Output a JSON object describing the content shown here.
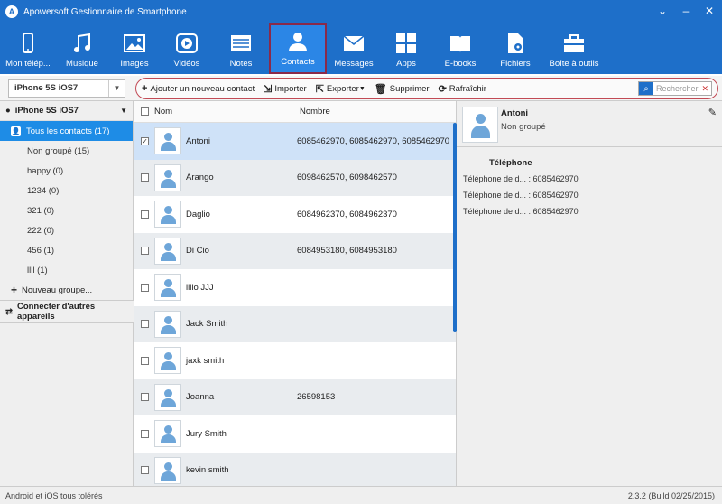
{
  "window": {
    "title": "Apowersoft Gestionnaire de Smartphone",
    "controls": [
      "⌄",
      "–",
      "✕"
    ]
  },
  "toolbar": {
    "items": [
      {
        "label": "Mon télép...",
        "icon": "phone-icon"
      },
      {
        "label": "Musique",
        "icon": "music-icon"
      },
      {
        "label": "Images",
        "icon": "images-icon"
      },
      {
        "label": "Vidéos",
        "icon": "video-icon"
      },
      {
        "label": "Notes",
        "icon": "notes-icon"
      },
      {
        "label": "Contacts",
        "icon": "contacts-icon"
      },
      {
        "label": "Messages",
        "icon": "messages-icon"
      },
      {
        "label": "Apps",
        "icon": "apps-icon"
      },
      {
        "label": "E-books",
        "icon": "ebook-icon"
      },
      {
        "label": "Fichiers",
        "icon": "files-icon"
      },
      {
        "label": "Boîte à outils",
        "icon": "toolbox-icon"
      }
    ],
    "active": "Contacts"
  },
  "device_select": {
    "value": "iPhone 5S iOS7"
  },
  "actions": {
    "add": "Ajouter un nouveau contact",
    "import": "Importer",
    "export": "Exporter",
    "delete": "Supprimer",
    "refresh": "Rafraîchir"
  },
  "search": {
    "placeholder": "Rechercher"
  },
  "sidebar": {
    "device": "iPhone 5S iOS7",
    "groups": [
      {
        "label": "Tous les contacts (17)"
      },
      {
        "label": "Non groupé (15)"
      },
      {
        "label": "happy (0)"
      },
      {
        "label": "1234 (0)"
      },
      {
        "label": "321 (0)"
      },
      {
        "label": "222 (0)"
      },
      {
        "label": "456 (1)"
      },
      {
        "label": "llll (1)"
      }
    ],
    "new_group": "Nouveau groupe...",
    "connect": "Connecter d'autres appareils"
  },
  "list": {
    "col_name": "Nom",
    "col_number": "Nombre",
    "rows": [
      {
        "name": "Antoni",
        "number": "6085462970, 6085462970, 6085462970",
        "checked": true
      },
      {
        "name": "Arango",
        "number": "6098462570, 6098462570",
        "checked": false
      },
      {
        "name": "Daglio",
        "number": "6084962370, 6084962370",
        "checked": false
      },
      {
        "name": "Di Cio",
        "number": "6084953180, 6084953180",
        "checked": false
      },
      {
        "name": "iliio JJJ",
        "number": "",
        "checked": false
      },
      {
        "name": "Jack Smith",
        "number": "",
        "checked": false
      },
      {
        "name": "jaxk smith",
        "number": "",
        "checked": false
      },
      {
        "name": "Joanna",
        "number": "26598153",
        "checked": false
      },
      {
        "name": "Jury Smith",
        "number": "",
        "checked": false
      },
      {
        "name": "kevin smith",
        "number": "",
        "checked": false
      }
    ]
  },
  "detail": {
    "name": "Antoni",
    "group": "Non groupé",
    "section": "Téléphone",
    "phones": [
      "Téléphone de d... : 6085462970",
      "Téléphone de d... : 6085462970",
      "Téléphone de d... : 6085462970"
    ]
  },
  "status": {
    "left": "Android et iOS tous tolérés",
    "right": "2.3.2 (Build 02/25/2015)"
  },
  "colors": {
    "accent": "#1e6fc9",
    "selected": "#1e8ce6",
    "highlight": "#c24a55"
  }
}
